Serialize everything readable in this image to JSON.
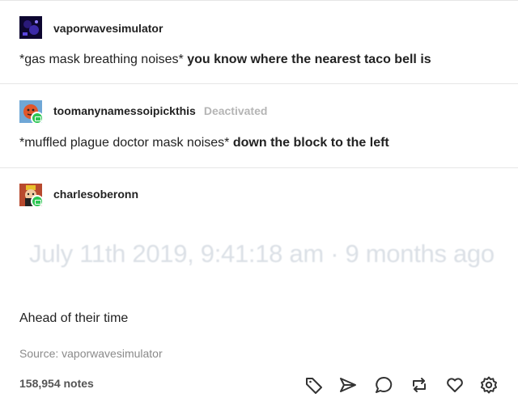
{
  "posts": [
    {
      "username": "vaporwavesimulator",
      "text_plain": "*gas mask breathing noises* ",
      "text_bold": "you know where the nearest taco bell is"
    },
    {
      "username": "toomanynamessoipickthis",
      "status": "Deactivated",
      "text_plain": "*muffled plague doctor mask noises* ",
      "text_bold": "down the block to the left"
    },
    {
      "username": "charlesoberonn",
      "timestamp": "July 11th 2019, 9:41:18 am · 9 months ago",
      "text": "Ahead of their time"
    }
  ],
  "source": "Source: vaporwavesimulator",
  "notes": "158,954 notes",
  "actions": [
    {
      "icon": "tag-icon"
    },
    {
      "icon": "share-icon"
    },
    {
      "icon": "reply-icon"
    },
    {
      "icon": "reblog-icon"
    },
    {
      "icon": "like-icon"
    },
    {
      "icon": "settings-icon"
    }
  ],
  "colors": {
    "reblog_badge": "#2dc653",
    "deactivated": "#b5b5b5",
    "timestamp": "#dbe0e6",
    "divider": "#e6e6e6"
  }
}
